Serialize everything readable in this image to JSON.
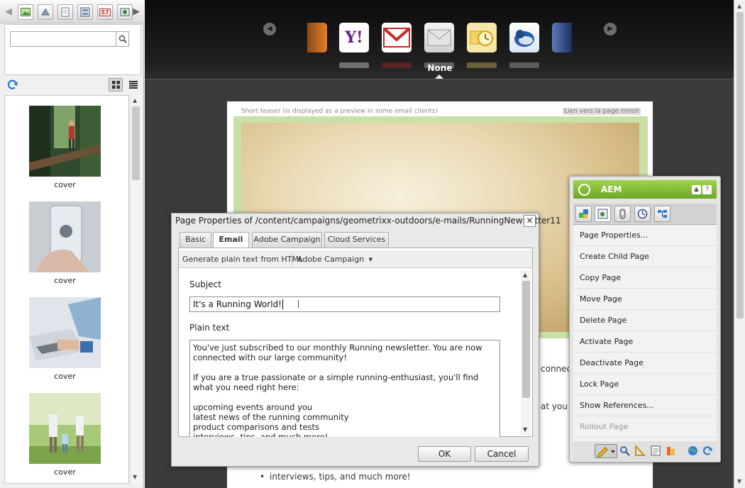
{
  "left_panel": {
    "tabs": [
      "images-icon",
      "product-icon",
      "document-icon",
      "page-icon",
      "calendar-icon",
      "flash-icon"
    ],
    "tab_calendar_text": "57",
    "search": {
      "value": "",
      "placeholder": ""
    },
    "assets": [
      {
        "caption": "cover",
        "image": "forest-hiker"
      },
      {
        "caption": "cover",
        "image": "smartphone-cloud"
      },
      {
        "caption": "cover",
        "image": "laptop-typing"
      },
      {
        "caption": "cover",
        "image": "family-walking"
      }
    ]
  },
  "carousel": {
    "clients": [
      "orange-client-icon",
      "yahoo-mail-icon",
      "gmail-icon",
      "generic-mail-icon",
      "outlook-icon",
      "thunderbird-icon",
      "blue-client-icon"
    ],
    "yahoo_text": "Y!",
    "selected_label": "None"
  },
  "email_page": {
    "teaser": "Short teaser (is displayed as a preview in some email clients)",
    "mirror_link": "Lien vers la page miroir",
    "fragment_1": "connec",
    "fragment_2": "at you n",
    "bullet": "interviews, tips, and much more!"
  },
  "dialog": {
    "title": "Page Properties of /content/campaigns/geometrixx-outdoors/e-mails/RunningNewsletter11",
    "close": "✕",
    "tabs": [
      {
        "label": "Basic",
        "active": false
      },
      {
        "label": "Email",
        "active": true
      },
      {
        "label": "Adobe Campaign",
        "active": false
      },
      {
        "label": "Cloud Services",
        "active": false
      }
    ],
    "toolbar": {
      "generate_plain_text": "Generate plain text from HTML",
      "adobe_campaign_menu": "Adobe Campaign"
    },
    "subject_label": "Subject",
    "subject_value": "It's a Running World!",
    "plain_text_label": "Plain text",
    "plain_text_value": "You've just subscribed to our monthly Running newsletter. You are now connected with our large community!\n\nIf you are a true passionate or a simple running-enthusiast, you'll find what you need right here:\n\nupcoming events around you\nlatest news of the running community\nproduct comparisons and tests\ninterviews, tips, and much more!",
    "ok": "OK",
    "cancel": "Cancel"
  },
  "sidekick": {
    "title": "AEM",
    "minimize": "▲",
    "help": "?",
    "tabs": [
      "components-icon",
      "page-icon",
      "versioning-icon",
      "workflow-icon",
      "site-structure-icon"
    ],
    "items": [
      {
        "label": "Page Properties...",
        "enabled": true
      },
      {
        "label": "Create Child Page",
        "enabled": true
      },
      {
        "label": "Copy Page",
        "enabled": true
      },
      {
        "label": "Move Page",
        "enabled": true
      },
      {
        "label": "Delete Page",
        "enabled": true
      },
      {
        "label": "Activate Page",
        "enabled": true
      },
      {
        "label": "Deactivate Page",
        "enabled": true
      },
      {
        "label": "Lock Page",
        "enabled": true
      },
      {
        "label": "Show References...",
        "enabled": true
      },
      {
        "label": "Rollout Page",
        "enabled": false
      }
    ],
    "footer_icons": [
      "edit-mode-icon",
      "preview-mode-icon",
      "design-mode-icon",
      "page-properties-icon",
      "scaffolding-icon",
      "sites-admin-icon",
      "refresh-icon"
    ]
  },
  "colors": {
    "accent_green": "#8cc63f",
    "hero_frame": "#c8e1a5",
    "carousel_bg": "#1a1a1a"
  }
}
